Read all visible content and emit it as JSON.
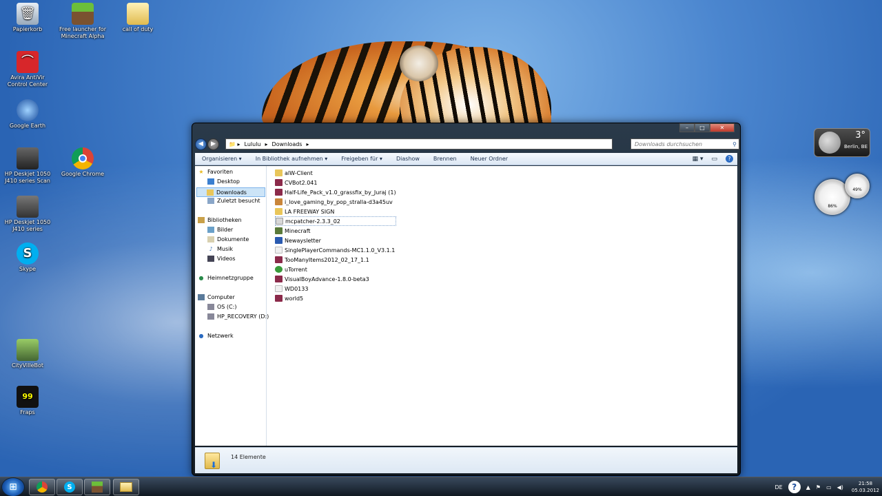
{
  "desktop": {
    "icons": [
      {
        "label": "Papierkorb",
        "icon": "recycle-bin-icon"
      },
      {
        "label": "Free launcher for Minecraft Alpha",
        "icon": "minecraft-icon"
      },
      {
        "label": "call of duty",
        "icon": "folder-icon"
      },
      {
        "label": "Avira AntiVir Control Center",
        "icon": "avira-icon"
      },
      {
        "label": "Google Earth",
        "icon": "google-earth-icon"
      },
      {
        "label": "HP Deskjet 1050 J410 series Scan",
        "icon": "scanner-icon"
      },
      {
        "label": "Google Chrome",
        "icon": "chrome-icon"
      },
      {
        "label": "HP Deskjet 1050 J410 series",
        "icon": "printer-icon"
      },
      {
        "label": "Skype",
        "icon": "skype-icon"
      },
      {
        "label": "CityVilleBot",
        "icon": "cityvillebot-icon"
      },
      {
        "label": "Fraps",
        "icon": "fraps-icon"
      }
    ]
  },
  "gadgets": {
    "weather": {
      "temp": "3°",
      "city": "Berlin, BE"
    },
    "cpu_meter": {
      "cpu": "86%",
      "ram": "49%"
    }
  },
  "window": {
    "address": {
      "crumbs": [
        "Lululu",
        "Downloads"
      ]
    },
    "search_placeholder": "Downloads durchsuchen",
    "toolbar": {
      "organize": "Organisieren ▾",
      "library": "In Bibliothek aufnehmen ▾",
      "share": "Freigeben für ▾",
      "slideshow": "Diashow",
      "burn": "Brennen",
      "new_folder": "Neuer Ordner"
    },
    "nav": {
      "favorites": "Favoriten",
      "desktop": "Desktop",
      "downloads": "Downloads",
      "recent": "Zuletzt besucht",
      "libraries": "Bibliotheken",
      "pictures": "Bilder",
      "documents": "Dokumente",
      "music": "Musik",
      "videos": "Videos",
      "homegroup": "Heimnetzgruppe",
      "computer": "Computer",
      "drive_c": "OS (C:)",
      "drive_d": "HP_RECOVERY (D:)",
      "network": "Netzwerk"
    },
    "files": [
      {
        "name": "alW-Client",
        "color": "#e9c65a"
      },
      {
        "name": "CVBot2.041",
        "color": "#8b2a4a"
      },
      {
        "name": "Half-Life_Pack_v1.0_grassfix_by_Juraj (1)",
        "color": "#8b2a4a"
      },
      {
        "name": "i_love_gaming_by_pop_stralla-d3a45uv",
        "color": "#c9853a"
      },
      {
        "name": "LA FREEWAY SIGN",
        "color": "#e9c65a"
      },
      {
        "name": "mcpatcher-2.3.3_02",
        "color": "#d8d8d8"
      },
      {
        "name": "Minecraft",
        "color": "#5a7a3a"
      },
      {
        "name": "Newaysletter",
        "color": "#2a5ab0"
      },
      {
        "name": "SinglePlayerCommands-MC1.1.0_V3.1.1",
        "color": "#f0f0f0"
      },
      {
        "name": "TooManyItems2012_02_17_1.1",
        "color": "#8b2a4a"
      },
      {
        "name": "uTorrent",
        "color": "#3a9a3a"
      },
      {
        "name": "VisualBoyAdvance-1.8.0-beta3",
        "color": "#8b2a4a"
      },
      {
        "name": "WD0133",
        "color": "#f0f0f0"
      },
      {
        "name": "world5",
        "color": "#8b2a4a"
      }
    ],
    "status": "14 Elemente"
  },
  "taskbar": {
    "lang": "DE",
    "time": "21:58",
    "date": "05.03.2012"
  }
}
